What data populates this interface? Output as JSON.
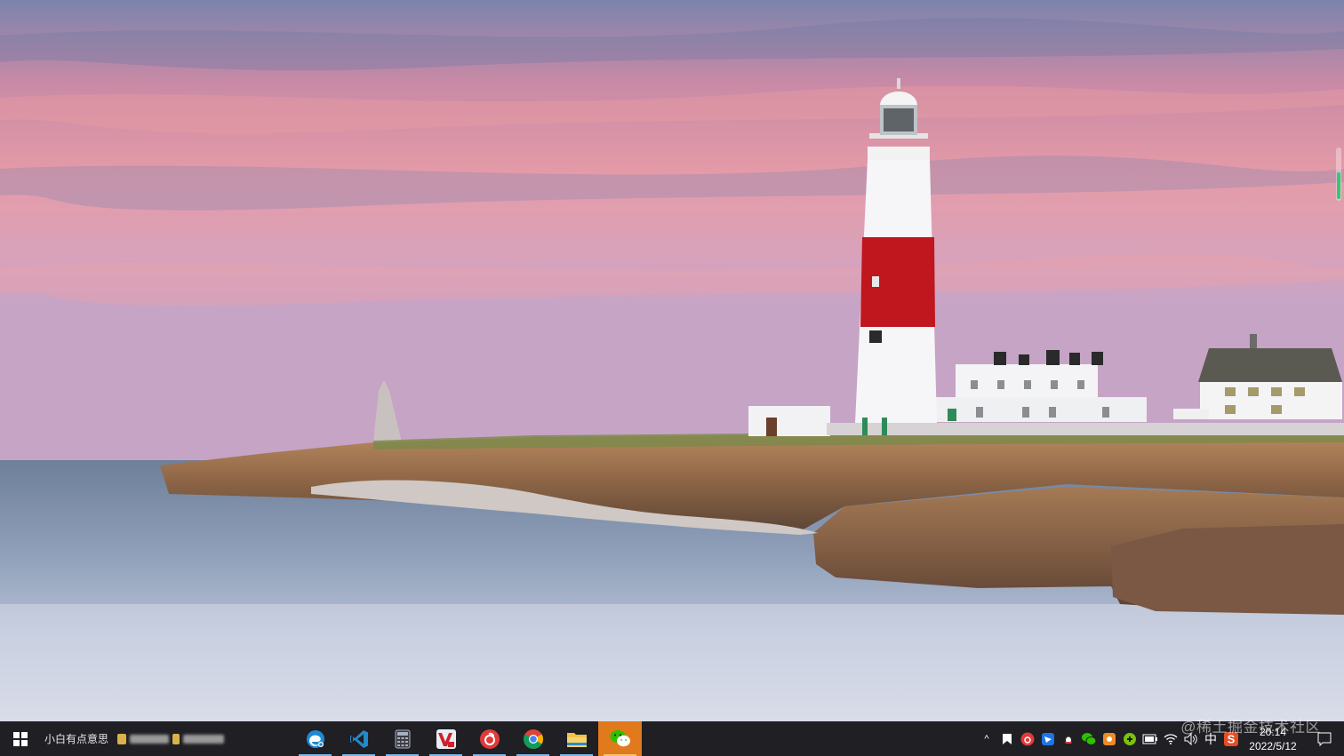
{
  "desktop": {
    "wallpaper": "lighthouse-on-cliff-at-dusk"
  },
  "watermark": "@稀土掘金技术社区",
  "taskbar": {
    "start_icon": "windows-logo-icon",
    "toolbar_label": "小白有点意思",
    "pinned_apps": [
      {
        "name": "edge-browser",
        "icon": "edge-icon",
        "running": true
      },
      {
        "name": "vscode",
        "icon": "vscode-icon",
        "running": true
      },
      {
        "name": "calculator",
        "icon": "calculator-icon",
        "running": true
      },
      {
        "name": "vivaldi-browser",
        "icon": "vivaldi-icon",
        "running": true
      },
      {
        "name": "netease-music",
        "icon": "netease-music-icon",
        "running": true
      },
      {
        "name": "chrome",
        "icon": "chrome-icon",
        "running": true
      },
      {
        "name": "file-explorer",
        "icon": "folder-icon",
        "running": true
      },
      {
        "name": "wechat",
        "icon": "wechat-icon",
        "running": true,
        "active": true
      }
    ],
    "tray": {
      "chevron": "^",
      "icons": [
        "bookmark-icon",
        "netease-tray-icon",
        "feishu-icon",
        "qq-icon",
        "wechat-tray-icon",
        "app-tray-icon",
        "green-app-icon",
        "battery-icon",
        "wifi-icon",
        "volume-icon"
      ],
      "ime": "中",
      "sogou": "S"
    },
    "clock": {
      "time": "20:14",
      "date": "2022/5/12"
    },
    "notification_icon": "notification-icon"
  },
  "colors": {
    "taskbar_bg": "#1f1f24",
    "active_app": "#e07a1c",
    "lighthouse_red": "#c0161e"
  }
}
